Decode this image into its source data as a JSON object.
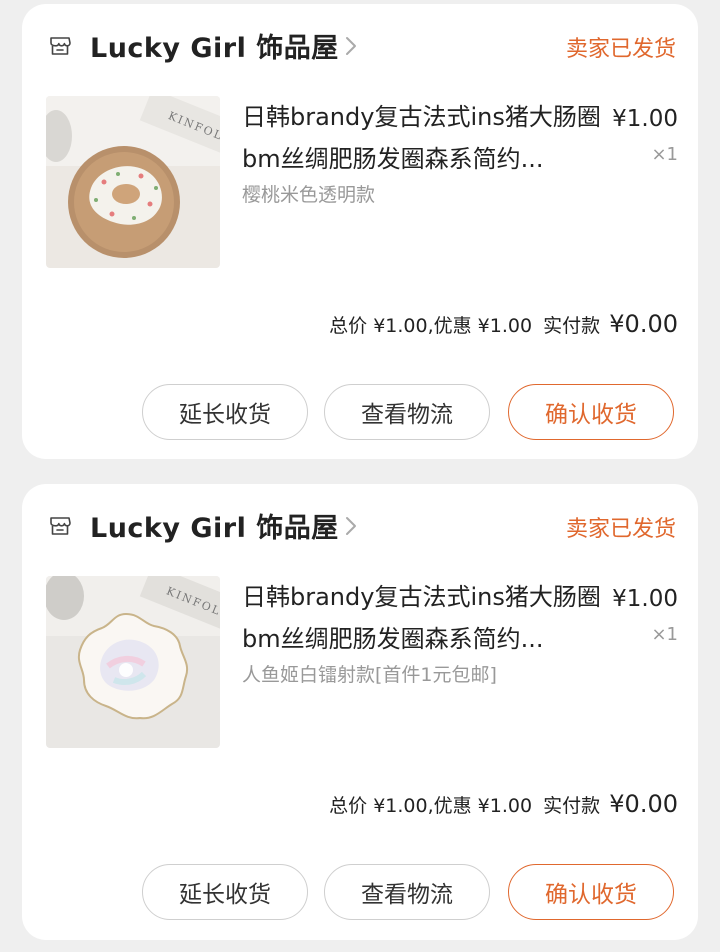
{
  "orders": [
    {
      "shop_name": "Lucky Girl 饰品屋",
      "status": "卖家已发货",
      "product": {
        "title": "日韩brandy复古法式ins猪大肠圈bm丝绸肥肠发圈森系简约...",
        "variant": "樱桃米色透明款",
        "price": "¥1.00",
        "quantity": "×1"
      },
      "summary": {
        "total_text": "总价 ¥1.00,优惠 ¥1.00",
        "paid_label": "实付款",
        "paid_value": "¥0.00"
      },
      "buttons": {
        "extend": "延长收货",
        "logistics": "查看物流",
        "confirm": "确认收货"
      },
      "photo_label": "KINFOLK"
    },
    {
      "shop_name": "Lucky Girl 饰品屋",
      "status": "卖家已发货",
      "product": {
        "title": "日韩brandy复古法式ins猪大肠圈bm丝绸肥肠发圈森系简约...",
        "variant": "人鱼姬白镭射款[首件1元包邮]",
        "price": "¥1.00",
        "quantity": "×1"
      },
      "summary": {
        "total_text": "总价 ¥1.00,优惠 ¥1.00",
        "paid_label": "实付款",
        "paid_value": "¥0.00"
      },
      "buttons": {
        "extend": "延长收货",
        "logistics": "查看物流",
        "confirm": "确认收货"
      },
      "photo_label": "KINFOLK"
    }
  ],
  "colors": {
    "accent": "#e0682e",
    "background": "#efefef",
    "card": "#ffffff",
    "muted_text": "#999999"
  },
  "icons": {
    "shop": "store-icon",
    "chevron": "chevron-right-icon"
  }
}
